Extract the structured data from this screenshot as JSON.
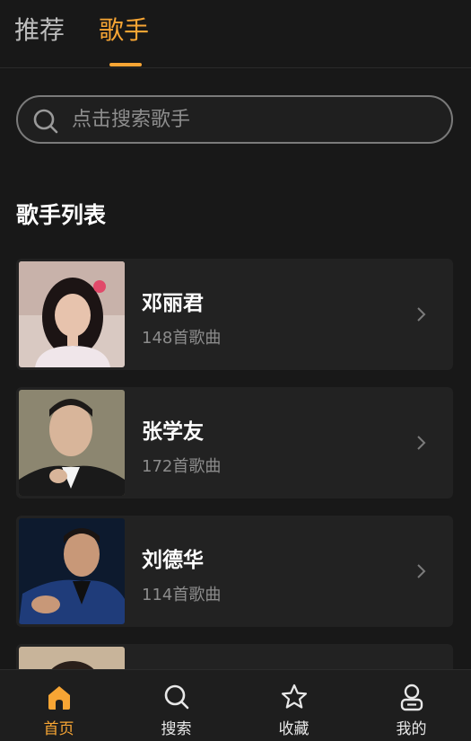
{
  "header": {
    "tabs": [
      {
        "label": "推荐"
      },
      {
        "label": "歌手"
      }
    ],
    "active_color": "#f7a534"
  },
  "search": {
    "placeholder": "点击搜索歌手"
  },
  "section": {
    "title": "歌手列表"
  },
  "singers": [
    {
      "name": "邓丽君",
      "count": "148首歌曲"
    },
    {
      "name": "张学友",
      "count": "172首歌曲"
    },
    {
      "name": "刘德华",
      "count": "114首歌曲"
    },
    {
      "name": "",
      "count": ""
    }
  ],
  "bottom_nav": {
    "items": [
      {
        "label": "首页",
        "icon": "home-icon"
      },
      {
        "label": "搜索",
        "icon": "search-icon"
      },
      {
        "label": "收藏",
        "icon": "star-icon"
      },
      {
        "label": "我的",
        "icon": "user-icon"
      }
    ]
  }
}
